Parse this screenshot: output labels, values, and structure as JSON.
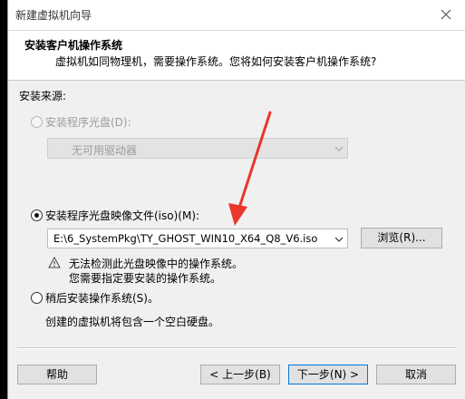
{
  "window": {
    "title": "新建虚拟机向导"
  },
  "header": {
    "heading": "安装客户机操作系统",
    "description": "虚拟机如同物理机，需要操作系统。您将如何安装客户机操作系统?"
  },
  "source": {
    "label": "安装来源:",
    "options": {
      "disc": {
        "label": "安装程序光盘(D):",
        "selected": false,
        "enabled": false
      },
      "iso": {
        "label": "安装程序光盘映像文件(iso)(M):",
        "selected": true,
        "enabled": true
      },
      "later": {
        "label": "稍后安装操作系统(S)。",
        "selected": false,
        "enabled": true
      }
    },
    "drive_select": {
      "value": "无可用驱动器"
    },
    "iso_select": {
      "value": "E:\\6_SystemPkg\\TY_GHOST_WIN10_X64_Q8_V6.iso"
    },
    "browse_label": "浏览(R)...",
    "warning_line1": "无法检测此光盘映像中的操作系统。",
    "warning_line2": "您需要指定要安装的操作系统。",
    "later_description": "创建的虚拟机将包含一个空白硬盘。"
  },
  "footer": {
    "help": "帮助",
    "back": "< 上一步(B)",
    "next": "下一步(N) >",
    "cancel": "取消"
  },
  "icons": {
    "close": "close-icon",
    "warning": "warning-icon",
    "chevron": "chevron-down-icon"
  },
  "colors": {
    "annotation_arrow": "#e8372b",
    "focus_border": "#0078d7"
  }
}
